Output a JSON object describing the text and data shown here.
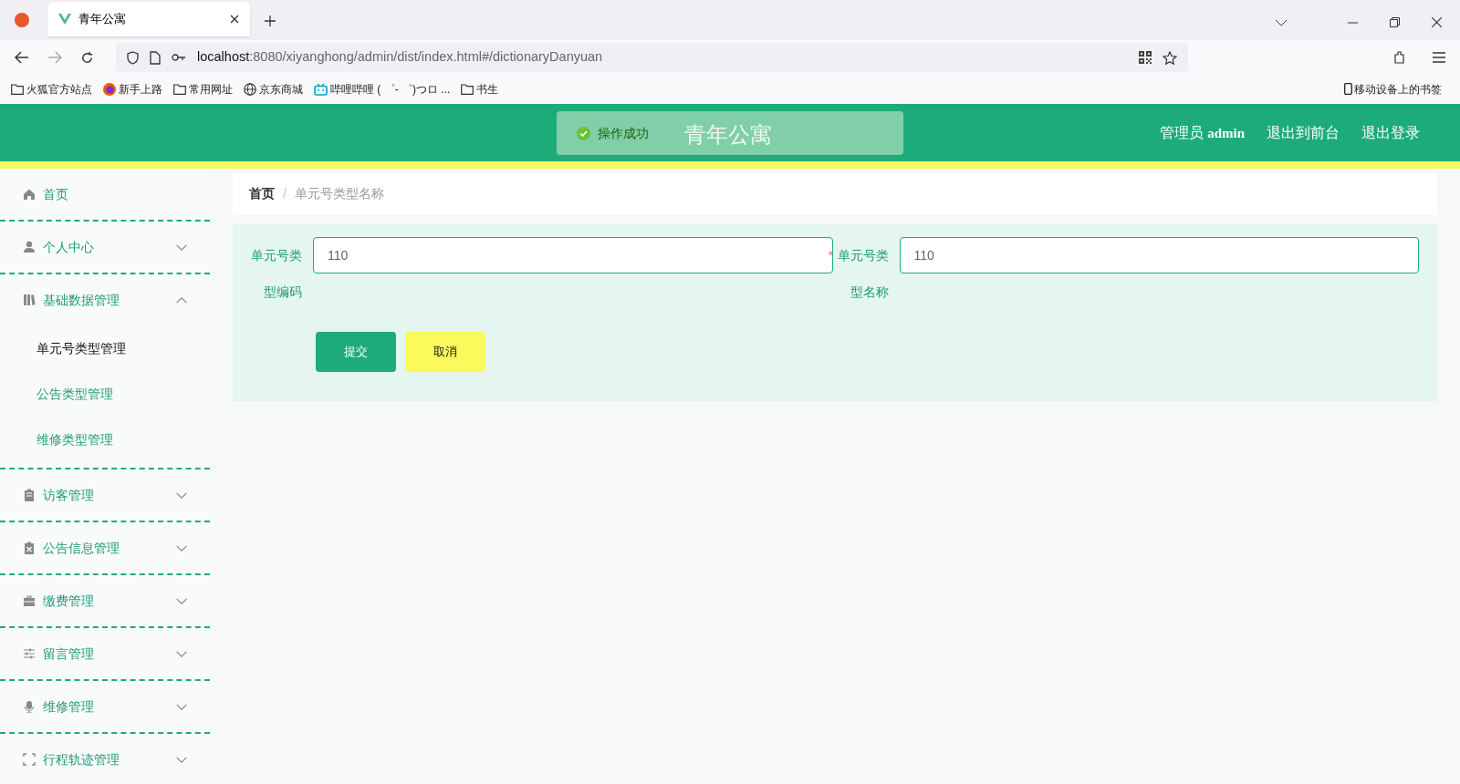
{
  "browser": {
    "tab_title": "青年公寓",
    "url_host": "localhost",
    "url_rest": ":8080/xiyanghong/admin/dist/index.html#/dictionaryDanyuan",
    "bookmarks": [
      {
        "label": "火狐官方站点",
        "kind": "folder"
      },
      {
        "label": "新手上路",
        "kind": "firefox"
      },
      {
        "label": "常用网址",
        "kind": "folder"
      },
      {
        "label": "京东商城",
        "kind": "globe"
      },
      {
        "label": "哔哩哔哩 ( ゜- ゜)つロ ...",
        "kind": "tv"
      },
      {
        "label": "书生",
        "kind": "folder"
      }
    ],
    "mobile_bookmarks": "移动设备上的书签"
  },
  "header": {
    "title": "青年公寓",
    "user_role": "管理员",
    "user_name": "admin",
    "links": [
      "退出到前台",
      "退出登录"
    ]
  },
  "toast": {
    "message": "操作成功"
  },
  "sidebar": {
    "items": [
      {
        "label": "首页"
      },
      {
        "label": "个人中心",
        "expanded": false
      },
      {
        "label": "基础数据管理",
        "expanded": true,
        "children": [
          {
            "label": "单元号类型管理",
            "selected": true
          },
          {
            "label": "公告类型管理",
            "selected": false
          },
          {
            "label": "维修类型管理",
            "selected": false
          }
        ]
      },
      {
        "label": "访客管理",
        "expanded": false
      },
      {
        "label": "公告信息管理",
        "expanded": false
      },
      {
        "label": "缴费管理",
        "expanded": false
      },
      {
        "label": "留言管理",
        "expanded": false
      },
      {
        "label": "维修管理",
        "expanded": false
      },
      {
        "label": "行程轨迹管理",
        "expanded": false
      }
    ]
  },
  "breadcrumb": {
    "items": [
      "首页",
      "单元号类型名称"
    ],
    "separator": "/"
  },
  "form": {
    "fields": [
      {
        "label": "单元号类型编码",
        "value": "110"
      },
      {
        "label": "单元号类型名称",
        "value": "110",
        "required_mark": "*"
      }
    ],
    "buttons": [
      {
        "label": "提交",
        "kind": "primary"
      },
      {
        "label": "取消",
        "kind": "secondary"
      }
    ]
  }
}
